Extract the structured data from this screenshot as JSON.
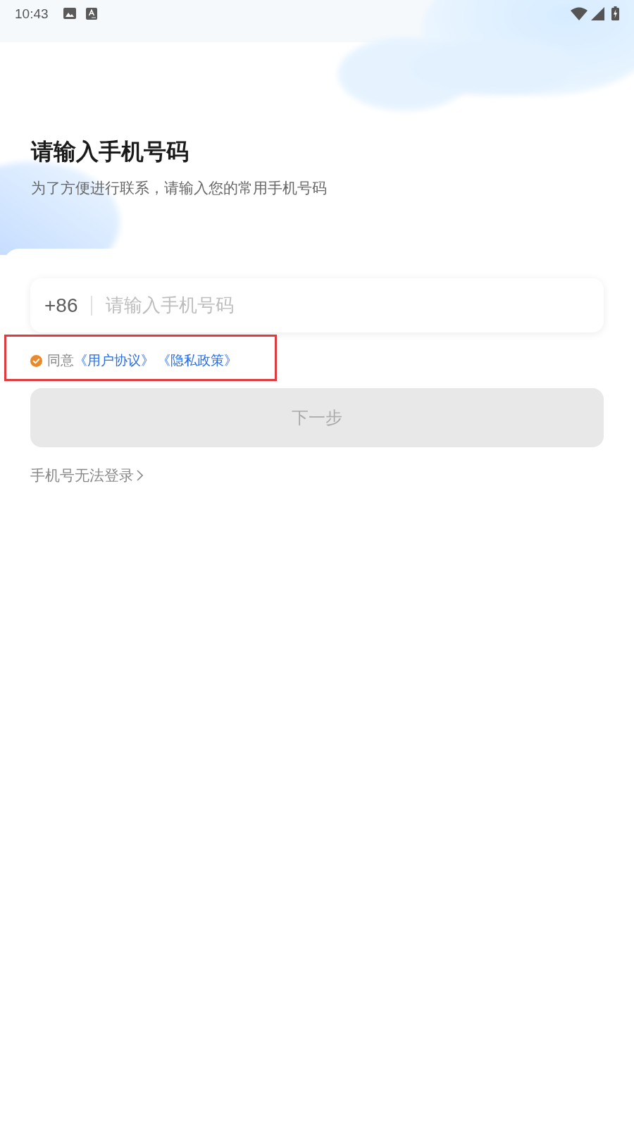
{
  "status_bar": {
    "time": "10:43"
  },
  "header": {
    "title": "请输入手机号码",
    "subtitle": "为了方便进行联系，请输入您的常用手机号码"
  },
  "phone_field": {
    "country_code": "+86",
    "placeholder": "请输入手机号码"
  },
  "agreement": {
    "checked": true,
    "highlighted": true,
    "label": "同意",
    "links": [
      "《用户协议》",
      "《隐私政策》"
    ]
  },
  "next_button": {
    "label": "下一步",
    "disabled": true
  },
  "help_link": {
    "label": "手机号无法登录"
  }
}
